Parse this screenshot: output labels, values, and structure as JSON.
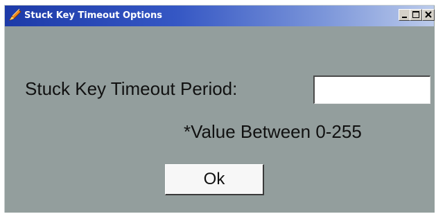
{
  "window": {
    "title": "Stuck Key Timeout Options",
    "controls": {
      "minimize_icon": "minimize-icon",
      "maximize_icon": "maximize-icon",
      "close_icon": "close-icon"
    },
    "app_icon": "pen-icon"
  },
  "form": {
    "field_label": "Stuck Key Timeout Period:",
    "field_value": "",
    "hint": "*Value Between 0-255",
    "ok_label": "Ok"
  },
  "colors": {
    "dialog_background": "#939e9d",
    "titlebar_start": "#1d3aa8",
    "titlebar_end": "#bccbeb"
  }
}
